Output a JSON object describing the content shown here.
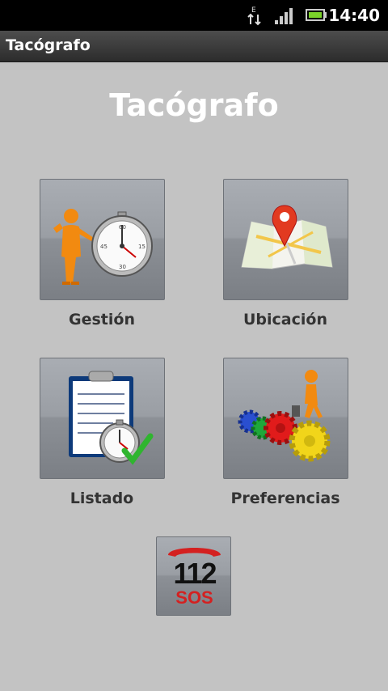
{
  "status_bar": {
    "time": "14:40",
    "data_letter": "E",
    "icons": [
      "data-transfer-icon",
      "signal-icon",
      "battery-icon"
    ]
  },
  "title_bar": {
    "title": "Tacógrafo"
  },
  "main": {
    "heading": "Tacógrafo",
    "tiles": [
      {
        "label": "Gestión",
        "icon": "stopwatch-person-icon"
      },
      {
        "label": "Ubicación",
        "icon": "map-pin-icon"
      },
      {
        "label": "Listado",
        "icon": "clipboard-stopwatch-icon"
      },
      {
        "label": "Preferencias",
        "icon": "gears-person-icon"
      }
    ],
    "emergency": {
      "number": "112",
      "text": "SOS",
      "icon": "emergency-phone-icon"
    }
  },
  "colors": {
    "background": "#c3c3c3",
    "status_bar": "#000000",
    "title_bar": "#3a3a3a",
    "sos_red": "#d42020"
  }
}
